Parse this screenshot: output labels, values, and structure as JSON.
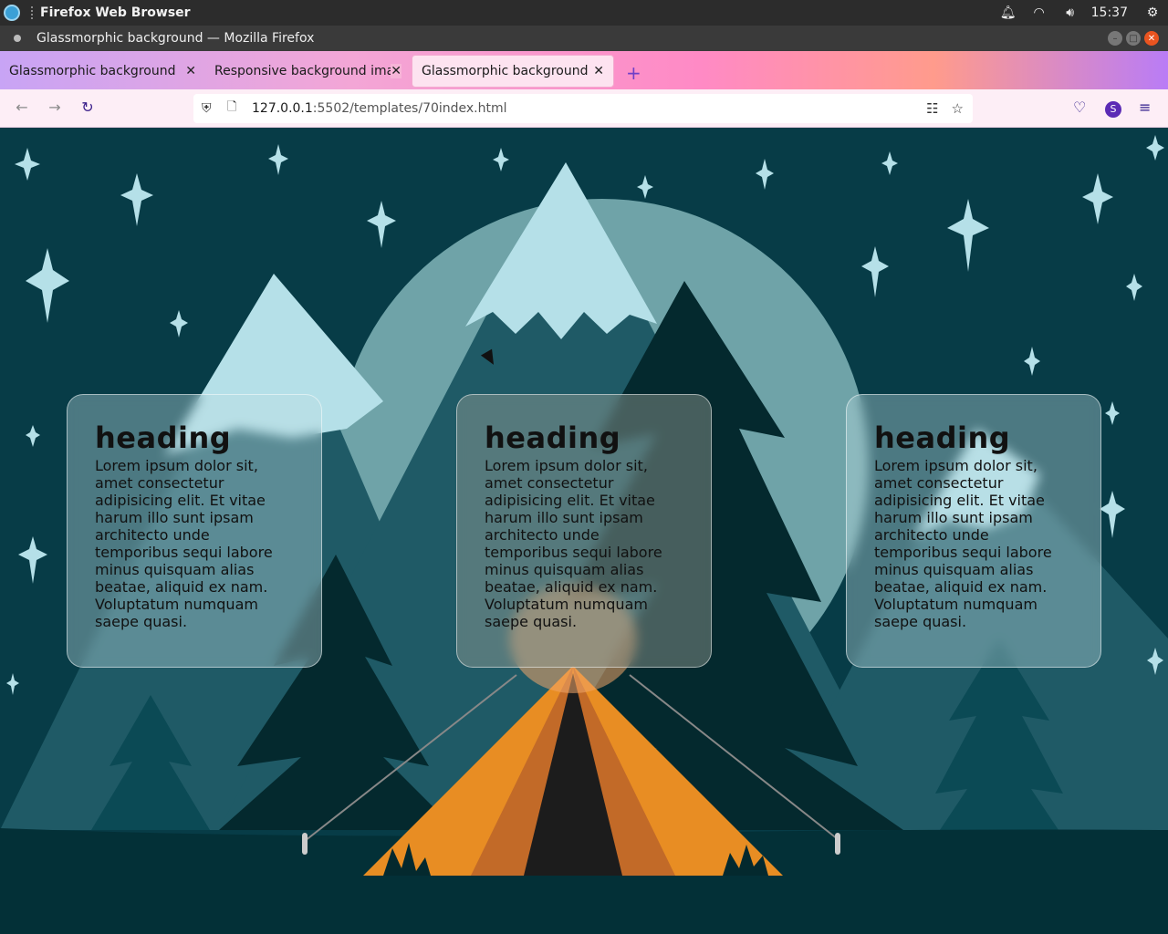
{
  "os": {
    "app_name": "Firefox Web Browser",
    "time": "15:37",
    "icons": [
      "bell-icon",
      "wifi-icon",
      "volume-icon",
      "power-icon"
    ]
  },
  "window": {
    "title": "Glassmorphic background — Mozilla Firefox"
  },
  "tabs": [
    {
      "label": "Glassmorphic background",
      "active": false
    },
    {
      "label": "Responsive background ima",
      "active": false
    },
    {
      "label": "Glassmorphic background",
      "active": true
    }
  ],
  "new_tab_symbol": "+",
  "urlbar": {
    "host": "127.0.0.1",
    "rest": ":5502/templates/70index.html"
  },
  "profile_initial": "S",
  "cards": [
    {
      "heading": "heading",
      "body": "Lorem ipsum dolor sit, amet consectetur adipisicing elit. Et vitae harum illo sunt ipsam architecto unde temporibus sequi labore minus quisquam alias beatae, aliquid ex nam. Voluptatum numquam saepe quasi."
    },
    {
      "heading": "heading",
      "body": "Lorem ipsum dolor sit, amet consectetur adipisicing elit. Et vitae harum illo sunt ipsam architecto unde temporibus sequi labore minus quisquam alias beatae, aliquid ex nam. Voluptatum numquam saepe quasi."
    },
    {
      "heading": "heading",
      "body": "Lorem ipsum dolor sit, amet consectetur adipisicing elit. Et vitae harum illo sunt ipsam architecto unde temporibus sequi labore minus quisquam alias beatae, aliquid ex nam. Voluptatum numquam saepe quasi."
    }
  ],
  "colors": {
    "sky": "#073c47",
    "moon": "#6fa3a8",
    "snow": "#b5e0e8",
    "tent": "#e88d23",
    "tent_shade": "#c26a28",
    "tent_door": "#1c1c1c"
  }
}
